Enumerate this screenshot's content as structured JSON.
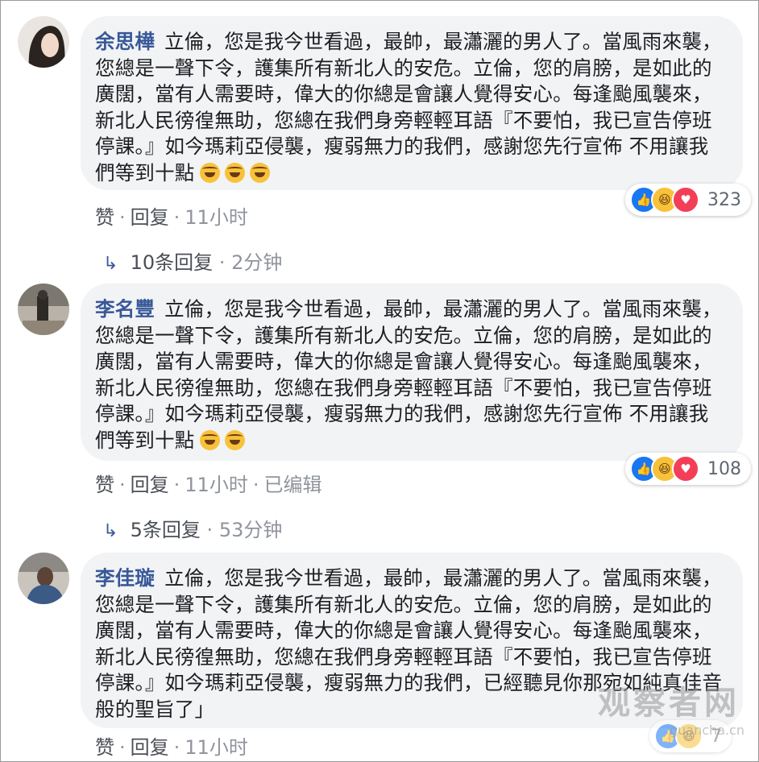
{
  "comments": [
    {
      "author": "余思樺",
      "text": "立倫，您是我今世看過，最帥，最瀟灑的男人了。當風雨來襲，您總是一聲下令，護集所有新北人的安危。立倫，您的肩膀，是如此的廣闊，當有人需要時，偉大的你總是會讓人覺得安心。每逢颱風襲來，新北人民徬徨無助，您總在我們身旁輕輕耳語『不要怕，我已宣告停班停課。』如今瑪莉亞侵襲，瘦弱無力的我們，感謝您先行宣佈 不用讓我們等到十點",
      "emoji_count": 3,
      "reaction_count": "323",
      "like_label": "赞",
      "reply_label": "回复",
      "time": "11小时",
      "edited": "",
      "replies_label": "10条回复",
      "replies_time": "2分钟"
    },
    {
      "author": "李名豐",
      "text": "立倫，您是我今世看過，最帥，最瀟灑的男人了。當風雨來襲，您總是一聲下令，護集所有新北人的安危。立倫，您的肩膀，是如此的廣闊，當有人需要時，偉大的你總是會讓人覺得安心。每逢颱風襲來，新北人民徬徨無助，您總在我們身旁輕輕耳語『不要怕，我已宣告停班停課。』如今瑪莉亞侵襲，瘦弱無力的我們，感謝您先行宣佈 不用讓我們等到十點",
      "emoji_count": 2,
      "reaction_count": "108",
      "like_label": "赞",
      "reply_label": "回复",
      "time": "11小时",
      "edited": "已编辑",
      "replies_label": "5条回复",
      "replies_time": "53分钟"
    },
    {
      "author": "李佳璇",
      "text": "立倫，您是我今世看過，最帥，最瀟灑的男人了。當風雨來襲，您總是一聲下令，護集所有新北人的安危。立倫，您的肩膀，是如此的廣闊，當有人需要時，偉大的你總是會讓人覺得安心。每逢颱風襲來，新北人民徬徨無助，您總在我們身旁輕輕耳語『不要怕，我已宣告停班停課。』如今瑪莉亞侵襲，瘦弱無力的我們，已經聽見你那宛如純真佳音般的聖旨了」",
      "emoji_count": 0,
      "reaction_count": "7",
      "like_label": "赞",
      "reply_label": "回复",
      "time": "11小时",
      "edited": ""
    }
  ],
  "watermark": "观察者网",
  "watermark_sub": "guancha.cn",
  "colors": {
    "name": "#385898",
    "bubble": "#f2f3f5",
    "meta": "#90949c"
  },
  "icons": [
    "reply-arrow-icon",
    "like-reaction-icon",
    "haha-reaction-icon",
    "love-reaction-icon",
    "haha-emoji-icon"
  ]
}
